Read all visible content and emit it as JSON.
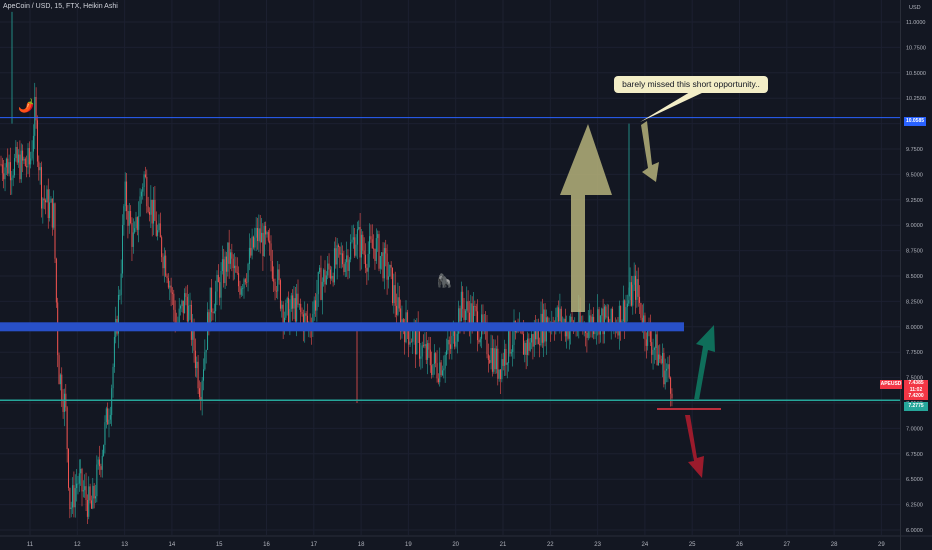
{
  "header": {
    "title": "ApeCoin / USD, 15, FTX, Heikin Ashi"
  },
  "callout": {
    "text": "barely missed this short opportunity.."
  },
  "price_axis": {
    "currency": "USD",
    "ticks": [
      "11.0000",
      "10.7500",
      "10.5000",
      "10.2500",
      "10.0000",
      "9.7500",
      "9.5000",
      "9.2500",
      "9.0000",
      "8.7500",
      "8.5000",
      "8.2500",
      "8.0000",
      "7.7500",
      "7.5000",
      "7.2500",
      "7.0000",
      "6.7500",
      "6.5000",
      "6.2500",
      "6.0000"
    ]
  },
  "time_axis": {
    "labels": [
      "11",
      "12",
      "13",
      "14",
      "15",
      "16",
      "17",
      "18",
      "19",
      "20",
      "21",
      "22",
      "23",
      "24",
      "25",
      "26",
      "27",
      "28",
      "29"
    ]
  },
  "tags": {
    "horizontal_line": "10.0585",
    "symbol": "APEUSD",
    "last_price": "7.4385",
    "countdown": "11:02",
    "close": "7.4200",
    "support": "7.2775"
  },
  "emojis": {
    "pepper": "🌶️",
    "gorilla": "🦍"
  },
  "colors": {
    "background": "#131722",
    "up": "#26a69a",
    "down": "#ef5350",
    "resistance_band": "#2850c8",
    "support_line": "#26a69a",
    "high_line": "#2962ff",
    "arrow_up_big": "#b5b27a",
    "arrow_down_small": "#b5b27a",
    "arrow_up_green": "#0f6e5a",
    "arrow_down_red": "#9b1b2c",
    "stop_line": "#f23645"
  },
  "chart_data": {
    "type": "candlestick",
    "title": "ApeCoin / USD, 15, FTX, Heikin Ashi",
    "ylim": [
      6.0,
      11.2
    ],
    "price_path": [
      [
        11.0,
        9.6
      ],
      [
        11.1,
        10.1
      ],
      [
        11.25,
        9.3
      ],
      [
        11.5,
        9.1
      ],
      [
        11.6,
        7.6
      ],
      [
        11.75,
        7.2
      ],
      [
        11.85,
        6.2
      ],
      [
        12.0,
        6.5
      ],
      [
        12.3,
        6.2
      ],
      [
        12.45,
        6.6
      ],
      [
        12.7,
        7.3
      ],
      [
        12.9,
        8.4
      ],
      [
        13.0,
        9.3
      ],
      [
        13.2,
        8.8
      ],
      [
        13.4,
        9.5
      ],
      [
        13.7,
        8.9
      ],
      [
        13.9,
        8.6
      ],
      [
        14.1,
        8.0
      ],
      [
        14.3,
        8.3
      ],
      [
        14.6,
        7.4
      ],
      [
        14.8,
        8.2
      ],
      [
        15.0,
        8.4
      ],
      [
        15.2,
        8.7
      ],
      [
        15.4,
        8.4
      ],
      [
        15.6,
        8.6
      ],
      [
        15.8,
        8.9
      ],
      [
        16.0,
        8.8
      ],
      [
        16.2,
        8.5
      ],
      [
        16.4,
        8.1
      ],
      [
        16.6,
        8.2
      ],
      [
        16.9,
        8.0
      ],
      [
        17.1,
        8.4
      ],
      [
        17.4,
        8.6
      ],
      [
        17.7,
        8.7
      ],
      [
        17.9,
        8.9
      ],
      [
        18.1,
        8.7
      ],
      [
        18.3,
        8.8
      ],
      [
        18.6,
        8.5
      ],
      [
        18.8,
        8.1
      ],
      [
        19.1,
        7.9
      ],
      [
        19.4,
        7.7
      ],
      [
        19.6,
        7.6
      ],
      [
        19.9,
        7.8
      ],
      [
        20.1,
        8.2
      ],
      [
        20.4,
        8.1
      ],
      [
        20.6,
        7.9
      ],
      [
        20.9,
        7.6
      ],
      [
        21.2,
        7.9
      ],
      [
        21.5,
        7.8
      ],
      [
        21.8,
        8.0
      ],
      [
        22.1,
        8.1
      ],
      [
        22.4,
        8.0
      ],
      [
        22.7,
        8.0
      ],
      [
        23.0,
        8.1
      ],
      [
        23.3,
        8.0
      ],
      [
        23.6,
        8.2
      ],
      [
        23.8,
        8.4
      ],
      [
        24.0,
        8.0
      ],
      [
        24.2,
        7.8
      ],
      [
        24.4,
        7.6
      ],
      [
        24.6,
        7.4385
      ]
    ],
    "annotations": [
      {
        "type": "horizontal_line",
        "value": 10.0585,
        "label": "10.0585"
      },
      {
        "type": "horizontal_band",
        "value": 8.0
      },
      {
        "type": "horizontal_line",
        "value": 7.2775,
        "label": "7.2775"
      },
      {
        "type": "callout",
        "text": "barely missed this short opportunity.."
      }
    ]
  }
}
